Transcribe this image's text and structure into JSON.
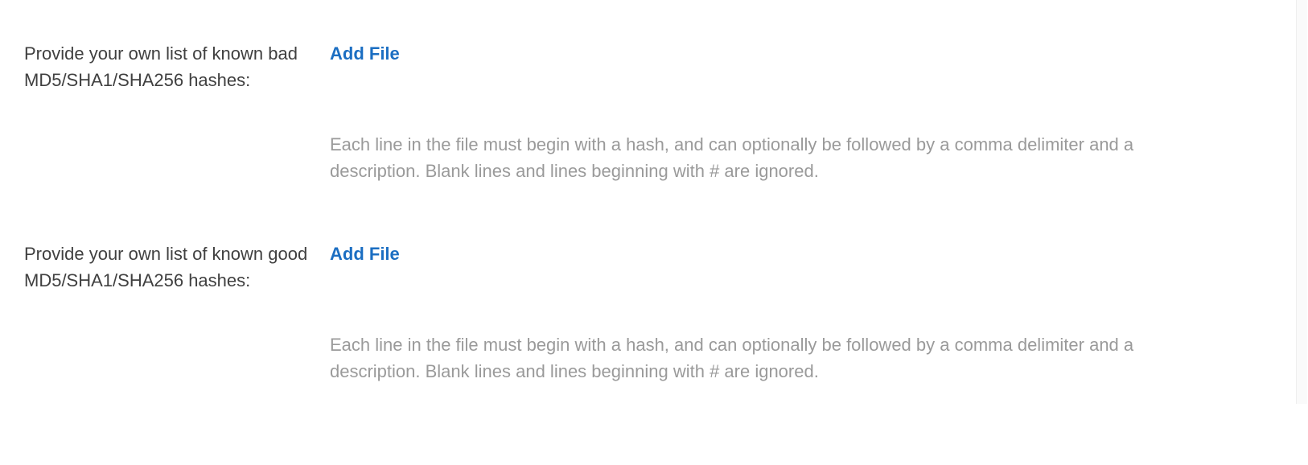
{
  "settings": {
    "bad_hashes": {
      "label": "Provide your own list of known bad MD5/SHA1/SHA256 hashes:",
      "action_label": "Add File",
      "help_text": "Each line in the file must begin with a hash, and can optionally be followed by a comma delimiter and a description. Blank lines and lines beginning with # are ignored."
    },
    "good_hashes": {
      "label": "Provide your own list of known good MD5/SHA1/SHA256 hashes:",
      "action_label": "Add File",
      "help_text": "Each line in the file must begin with a hash, and can optionally be followed by a comma delimiter and a description. Blank lines and lines beginning with # are ignored."
    }
  }
}
